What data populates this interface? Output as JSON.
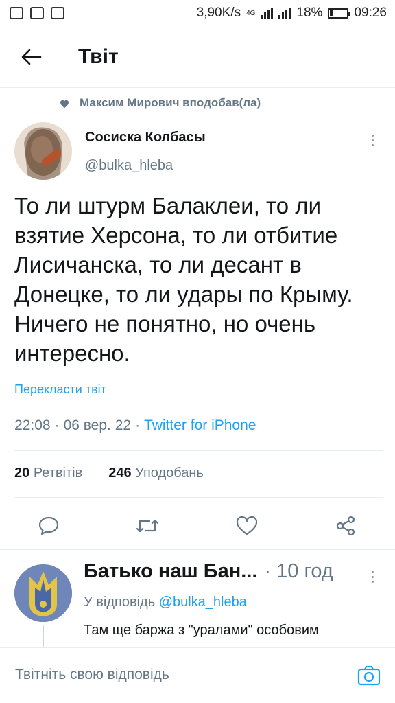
{
  "status_bar": {
    "speed": "3,90K/s",
    "network": "4G",
    "battery": "18%",
    "battery_level": 0.18,
    "time": "09:26"
  },
  "header": {
    "title": "Твіт"
  },
  "social_context": "Максим Мирович вподобав(ла)",
  "tweet": {
    "author_name": "Сосиска Колбасы",
    "author_handle": "@bulka_hleba",
    "text": "То ли штурм Балаклеи, то ли взятие Херсона, то ли отбитие Лисичанска, то ли десант в Донецке, то ли удары по Крыму. Ничего не понятно, но очень интересно.",
    "translate_label": "Перекласти твіт",
    "time": "22:08",
    "date": "06 вер. 22",
    "source": "Twitter for iPhone",
    "separator": "·",
    "retweets_count": "20",
    "retweets_label": "Ретвітів",
    "likes_count": "246",
    "likes_label": "Уподобань"
  },
  "reply": {
    "author_name": "Батько наш Бан...",
    "time": "· 10 год",
    "reply_to_label": "У відповідь",
    "reply_to_handle": "@bulka_hleba",
    "text": "Там ще баржа з \"уралами\" особовим"
  },
  "composer": {
    "placeholder": "Твітніть свою відповідь"
  },
  "colors": {
    "accent": "#1da1f2",
    "secondary_text": "#657786",
    "primary_text": "#14171a"
  },
  "icons": {
    "back": "arrow-left-icon",
    "like_context": "heart-icon",
    "more": "more-vertical-icon",
    "reply": "comment-icon",
    "retweet": "retweet-icon",
    "like": "heart-outline-icon",
    "share": "share-icon",
    "camera": "camera-icon"
  }
}
